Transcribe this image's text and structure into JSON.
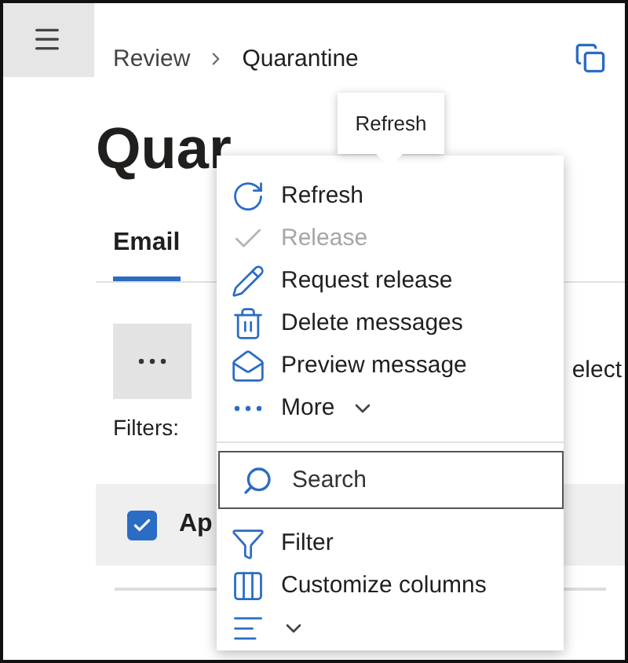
{
  "header": {
    "breadcrumb": [
      {
        "label": "Review",
        "current": false
      },
      {
        "label": "Quarantine",
        "current": true
      }
    ]
  },
  "title": "Quar",
  "tabs": [
    {
      "label": "Email",
      "selected": true
    }
  ],
  "selection_text": "elect",
  "filters_label": "Filters:",
  "row": {
    "checked": true,
    "text": "Ap"
  },
  "tooltip": "Refresh",
  "menu": {
    "actions": [
      {
        "label": "Refresh",
        "disabled": false
      },
      {
        "label": "Release",
        "disabled": true
      },
      {
        "label": "Request release",
        "disabled": false
      },
      {
        "label": "Delete messages",
        "disabled": false
      },
      {
        "label": "Preview message",
        "disabled": false
      },
      {
        "label": "More",
        "disabled": false,
        "dropdown": true
      }
    ],
    "search": {
      "placeholder": "Search"
    },
    "tools": [
      {
        "label": "Filter",
        "dropdown": false
      },
      {
        "label": "Customize columns",
        "dropdown": false
      },
      {
        "dropdown": true
      }
    ]
  }
}
